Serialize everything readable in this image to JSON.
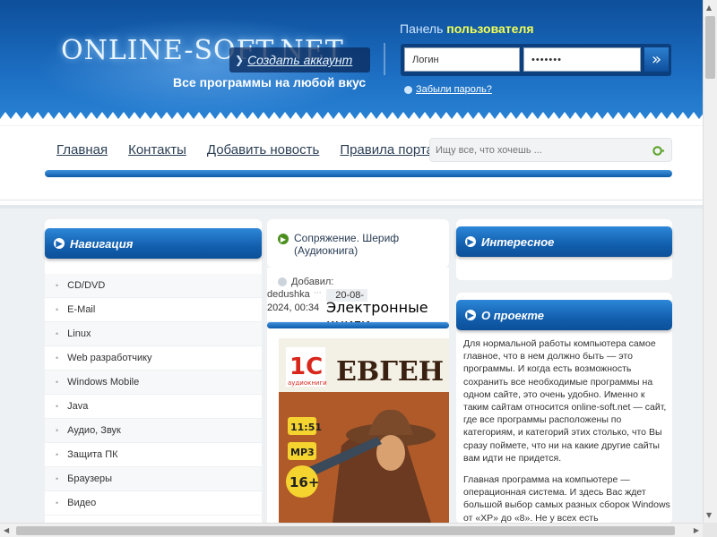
{
  "header": {
    "logo": "ONLINE-SOFT.NET",
    "slogan": "Все программы на любой вкус",
    "create_account": "Создать аккаунт",
    "panel_title_a": "Панель ",
    "panel_title_b": "пользователя",
    "login_value": "Логин",
    "password_value": "•••••••",
    "forgot_password": "Забыли пароль?"
  },
  "nav": {
    "items": [
      "Главная",
      "Контакты",
      "Добавить новость",
      "Правила портала"
    ],
    "search_placeholder": "Ищу все, что хочешь ..."
  },
  "sidebar": {
    "title": "Навигация",
    "items": [
      "CD/DVD",
      "E-Mail",
      "Linux",
      "Web разработчику",
      "Windows Mobile",
      "Java",
      "Аудио, Звук",
      "Защита ПК",
      "Браузеры",
      "Видео"
    ]
  },
  "news": {
    "title": "Сопряжение. Шериф (Аудиокнига)",
    "added_label": "Добавил:",
    "author": "dedushka",
    "date_line1": "20-08-",
    "date_line2": "2024, 00:34",
    "category": "Электронные книги",
    "cover_brand": "аудиокниги",
    "cover_word": "ЕВГЕН",
    "cover_time": "11:51",
    "cover_format": "MP3",
    "cover_age": "16+"
  },
  "right": {
    "interesting_title": "Интересное",
    "about_title": "О проекте",
    "about_p1": "Для нормальной работы компьютера самое главное, что в нем должно быть — это программы. И когда есть возможность сохранить все необходимые программы на одном сайте, это очень удобно. Именно к таким сайтам относится online-soft.net — сайт, где все программы расположены по категориям, и категорий этих столько, что Вы сразу поймете, что ни на какие другие сайты вам идти не придется.",
    "about_p2": "Главная программа на компьютере — операционная система. И здесь Вас ждет большой выбор самых разных сборок Windows от «XP» до «8». Не у всех есть"
  },
  "colors": {
    "header_blue": "#1b6cc0",
    "accent_yellow": "#f3ff55",
    "bar_blue": "#125fae"
  }
}
